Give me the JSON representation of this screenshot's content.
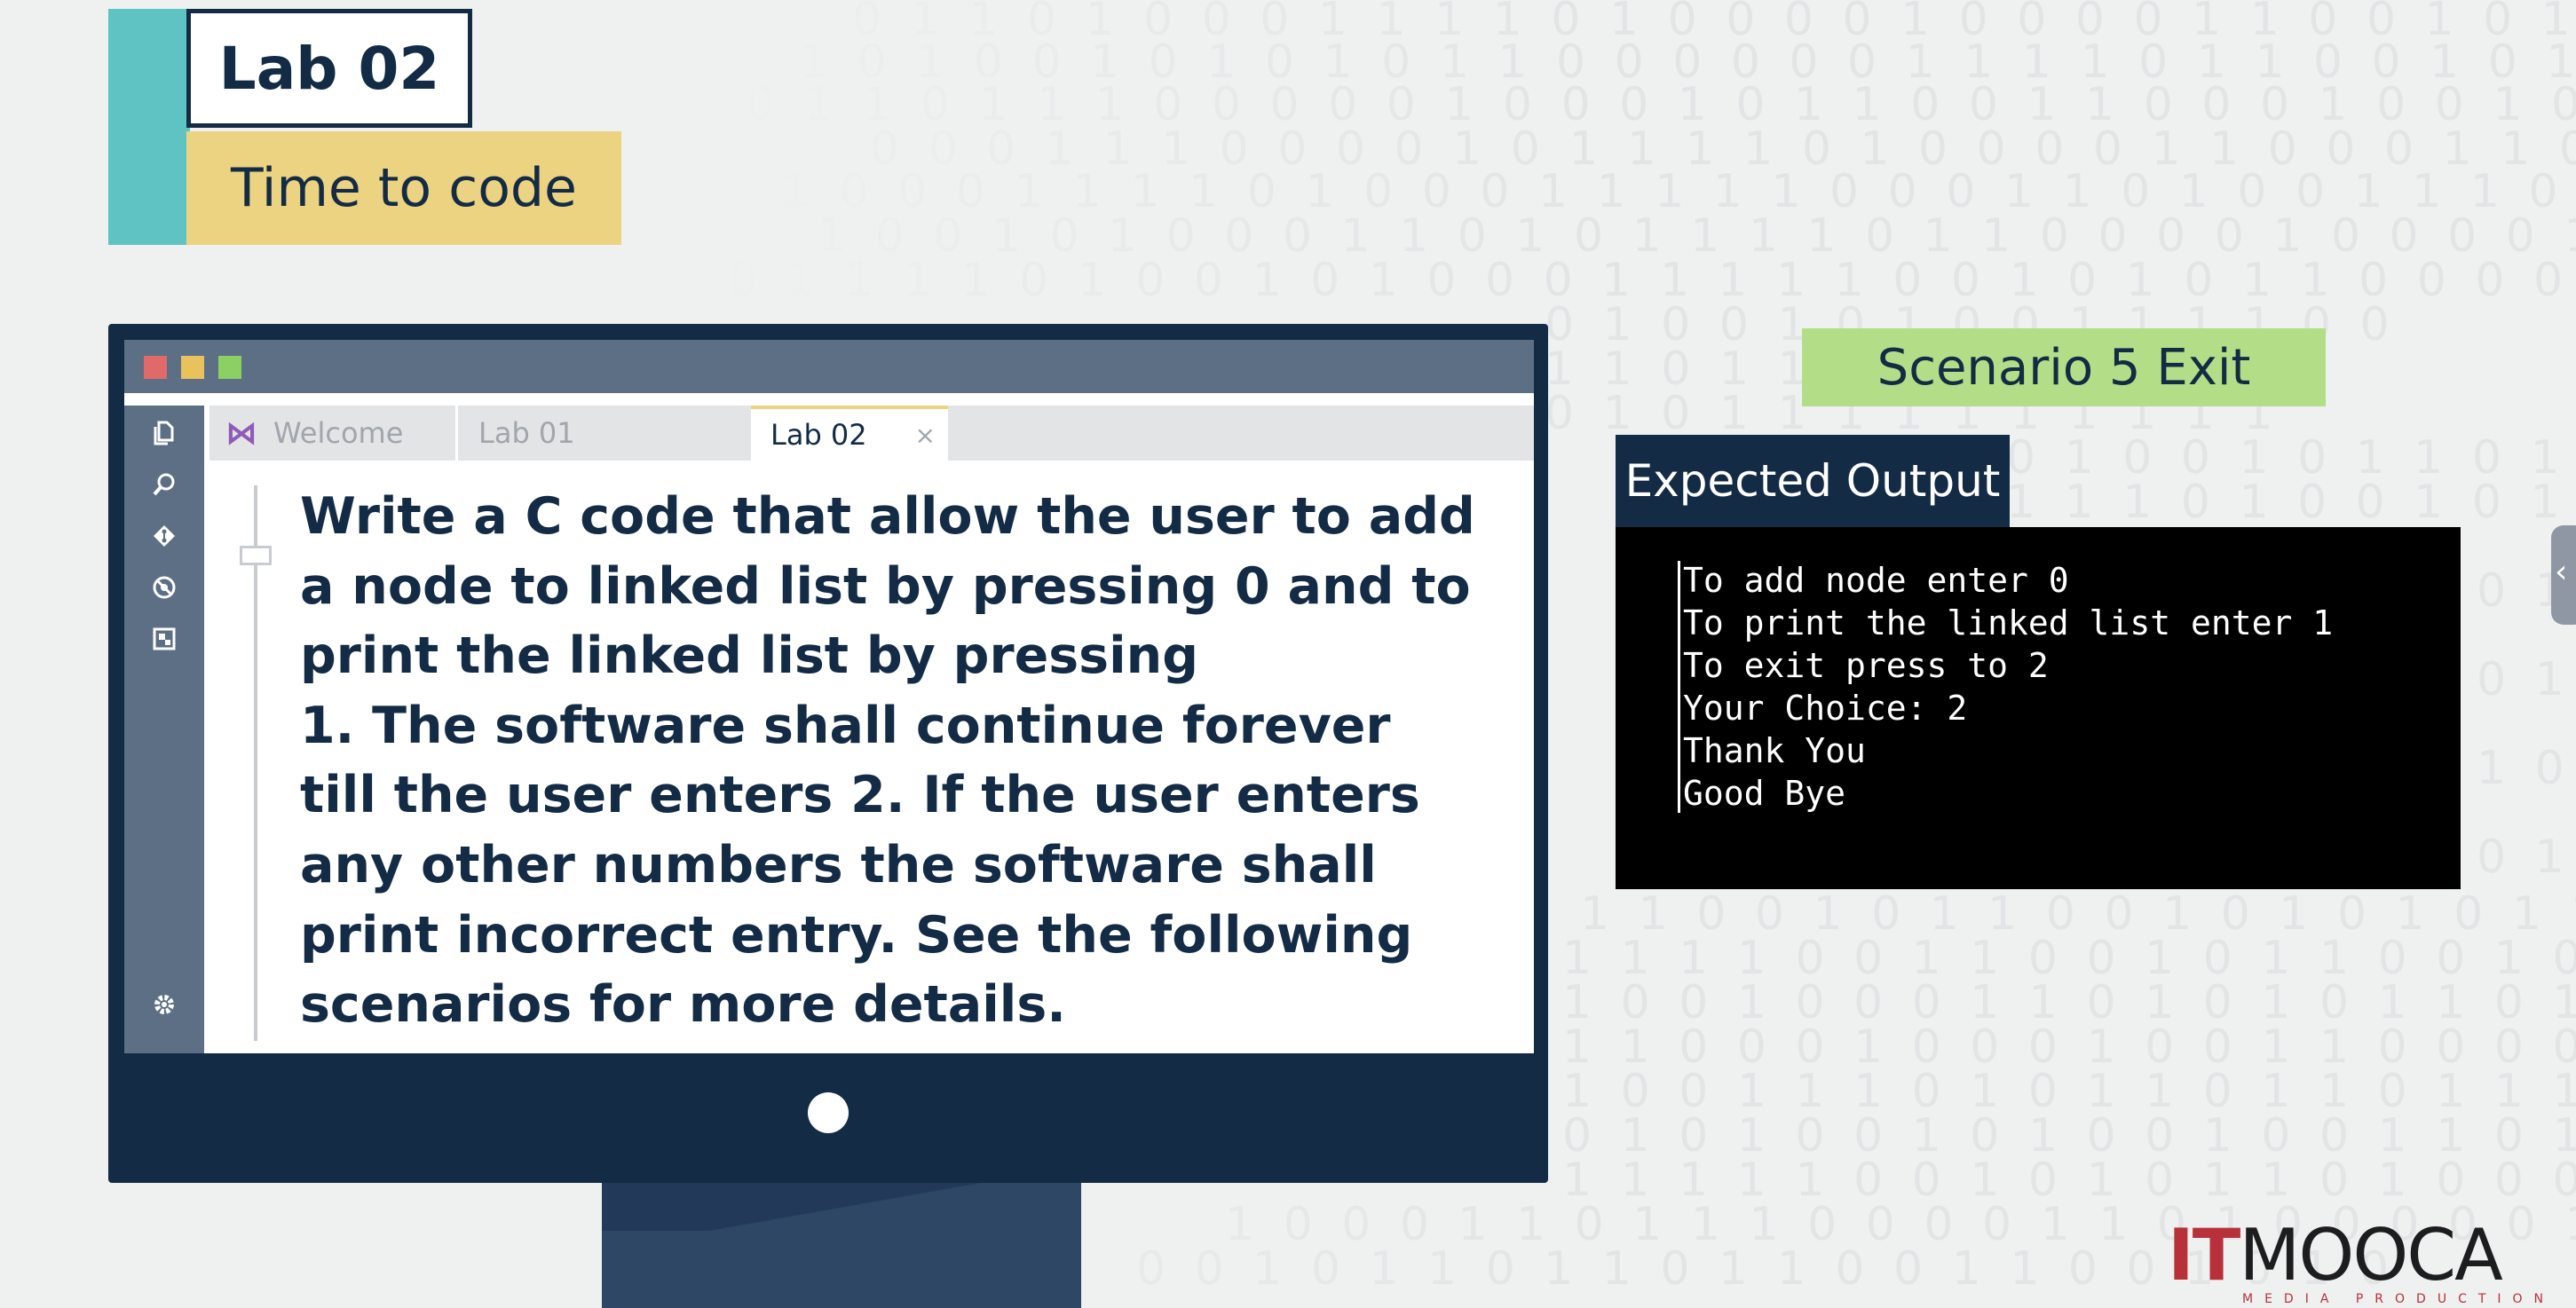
{
  "badge": {
    "title": "Lab 02",
    "subtitle": "Time to code"
  },
  "window": {
    "tabs": [
      {
        "label": "Welcome",
        "icon": "visual-studio-icon",
        "active": false
      },
      {
        "label": "Lab 01",
        "active": false
      },
      {
        "label": "Lab 02",
        "active": true,
        "close": "×"
      }
    ],
    "sidebar_icons": [
      "files-icon",
      "search-icon",
      "git-icon",
      "debug-icon",
      "extensions-icon",
      "gear-icon"
    ],
    "content_lines": [
      "Write a C code that allow the user to add",
      "a node to linked list by pressing 0 and to",
      "print the linked list by pressing",
      "1. The software shall continue forever",
      "till the user enters 2. If the user enters",
      "any other numbers the software shall",
      "print incorrect entry. See the following",
      "scenarios for more details."
    ]
  },
  "scenario": {
    "label": "Scenario 5 Exit"
  },
  "expected_output": {
    "label": "Expected Output",
    "lines": [
      "To add node enter 0",
      "To print the linked list enter 1",
      "To exit press to 2",
      "Your Choice: 2",
      "Thank You",
      "Good Bye"
    ]
  },
  "logo": {
    "brand_prefix": "IT",
    "brand": "MOOCA",
    "tagline": "MEDIA PRODUCTION"
  },
  "colors": {
    "navy": "#142b45",
    "teal": "#5fc3c4",
    "yellow": "#ecd381",
    "green": "#b3de87",
    "slate": "#5c6f84",
    "brand_red": "#b8313a"
  }
}
